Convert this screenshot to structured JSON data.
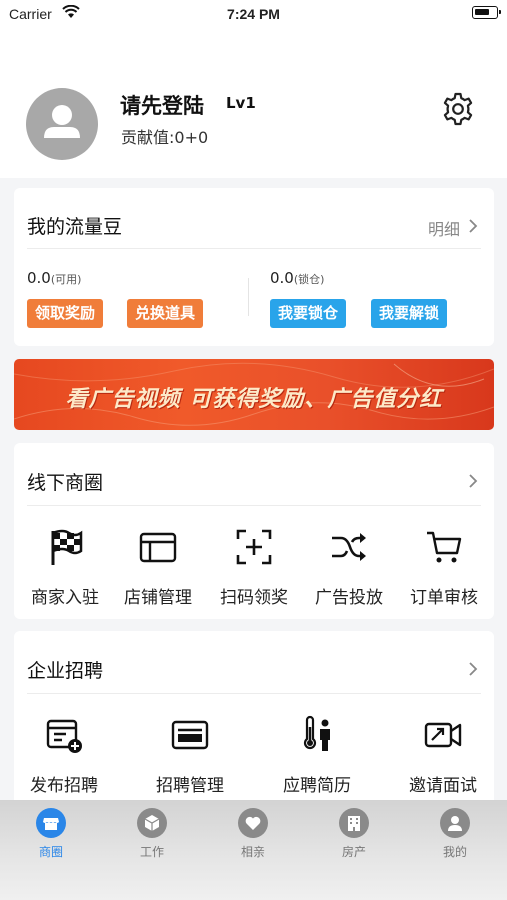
{
  "status_bar": {
    "carrier": "Carrier",
    "time": "7:24 PM"
  },
  "profile": {
    "name": "请先登陆",
    "level": "Lv1",
    "contribution": "贡献值:0+0"
  },
  "flow_beans": {
    "title": "我的流量豆",
    "detail_label": "明细",
    "available_value": "0.0",
    "available_label": "(可用)",
    "locked_value": "0.0",
    "locked_label": "(锁仓)",
    "buttons": [
      "领取奖励",
      "兑换道具",
      "我要锁仓",
      "我要解锁"
    ]
  },
  "banner": {
    "text": "看广告视频 可获得奖励、广告值分红"
  },
  "offline_business": {
    "title": "线下商圈",
    "items": [
      {
        "label": "商家入驻",
        "icon": "checkered-flag-icon"
      },
      {
        "label": "店铺管理",
        "icon": "storefront-icon"
      },
      {
        "label": "扫码领奖",
        "icon": "scan-icon"
      },
      {
        "label": "广告投放",
        "icon": "shuffle-icon"
      },
      {
        "label": "订单审核",
        "icon": "cart-icon"
      }
    ]
  },
  "recruitment": {
    "title": "企业招聘",
    "items": [
      {
        "label": "发布招聘",
        "icon": "post-job-icon"
      },
      {
        "label": "招聘管理",
        "icon": "id-card-icon"
      },
      {
        "label": "应聘简历",
        "icon": "thermometer-person-icon"
      },
      {
        "label": "邀请面试",
        "icon": "video-call-icon"
      }
    ]
  },
  "tab_bar": {
    "active": "商圈",
    "items": [
      {
        "label": "商圈",
        "icon": "store-icon"
      },
      {
        "label": "工作",
        "icon": "package-icon"
      },
      {
        "label": "相亲",
        "icon": "heart-icon"
      },
      {
        "label": "房产",
        "icon": "building-icon"
      },
      {
        "label": "我的",
        "icon": "user-icon"
      }
    ]
  },
  "colors": {
    "accent_blue": "#2a86e8",
    "orange": "#f07d3a",
    "sky_blue": "#29a4ea",
    "banner_red": "#e9502a"
  }
}
